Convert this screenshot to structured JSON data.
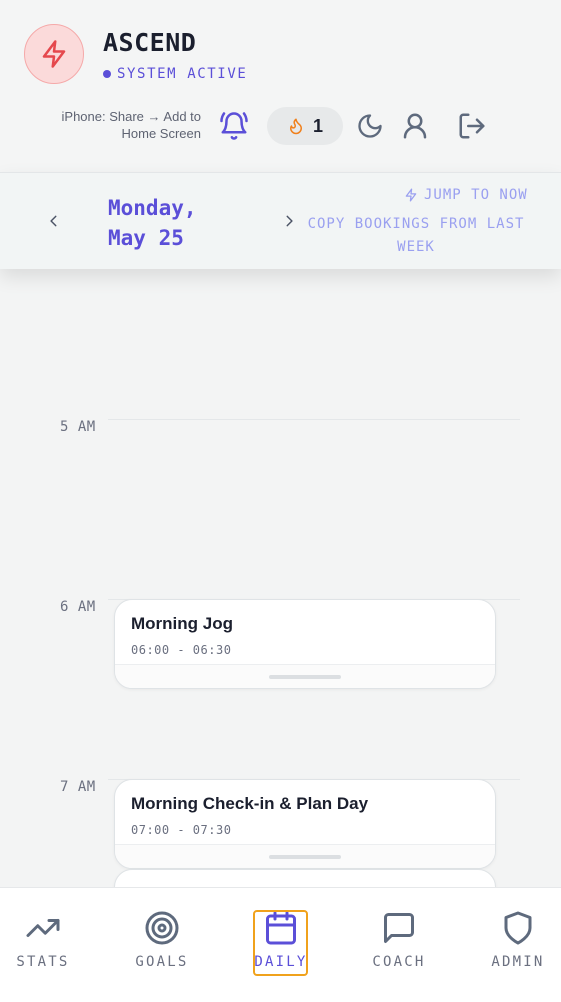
{
  "app": {
    "title": "ASCEND",
    "status": "SYSTEM ACTIVE",
    "install_hint": "iPhone: Share → Add to Home Screen",
    "streak_count": "1"
  },
  "datebar": {
    "date_line1": "Monday,",
    "date_line2": "May 25",
    "jump_label": "JUMP TO NOW",
    "copy_label": "COPY BOOKINGS FROM LAST WEEK"
  },
  "timeline": {
    "hours": [
      "5 AM",
      "6 AM",
      "7 AM"
    ],
    "events": [
      {
        "title": "Morning Jog",
        "time": "06:00 - 06:30"
      },
      {
        "title": "Morning Check-in & Plan Day",
        "time": "07:00 - 07:30"
      }
    ]
  },
  "nav": {
    "items": [
      {
        "label": "STATS",
        "icon": "trending-up-icon"
      },
      {
        "label": "GOALS",
        "icon": "target-icon"
      },
      {
        "label": "DAILY",
        "icon": "calendar-icon"
      },
      {
        "label": "COACH",
        "icon": "chat-icon"
      },
      {
        "label": "ADMIN",
        "icon": "shield-icon"
      }
    ],
    "active": "DAILY"
  },
  "colors": {
    "accent": "#5b4fd8",
    "logo_red": "#e5484d",
    "streak_flame": "#f0801c",
    "active_outline": "#f0a21c"
  }
}
